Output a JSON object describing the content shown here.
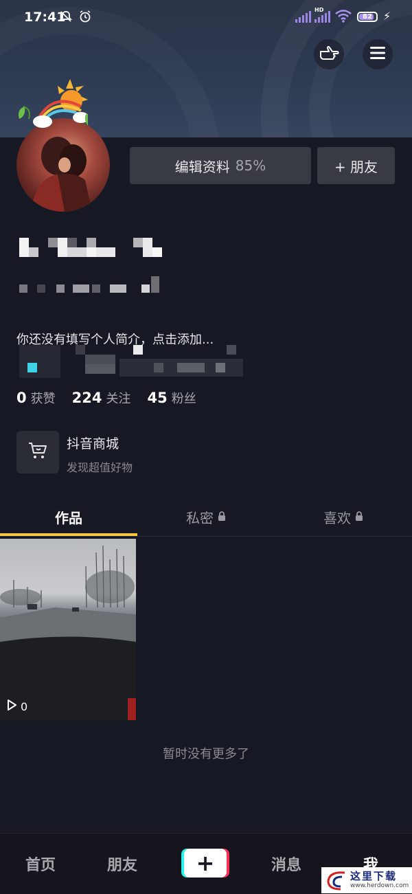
{
  "status_bar": {
    "time": "17:41",
    "battery": "82",
    "network": "HD"
  },
  "profile": {
    "edit_label": "编辑资料",
    "edit_percent": "85%",
    "add_friend_label": "+ 朋友",
    "bio": "你还没有填写个人简介，点击添加..."
  },
  "stats": [
    {
      "value": "0",
      "label": "获赞"
    },
    {
      "value": "224",
      "label": "关注"
    },
    {
      "value": "45",
      "label": "粉丝"
    }
  ],
  "shop": {
    "title": "抖音商城",
    "subtitle": "发现超值好物"
  },
  "tabs": [
    {
      "label": "作品",
      "locked": false
    },
    {
      "label": "私密",
      "locked": true
    },
    {
      "label": "喜欢",
      "locked": true
    }
  ],
  "video": {
    "play_count": "0"
  },
  "empty_text": "暂时没有更多了",
  "bottom_nav": [
    {
      "label": "首页"
    },
    {
      "label": "朋友"
    },
    {
      "label": "消息"
    },
    {
      "label": "我"
    }
  ],
  "watermark": {
    "text": "这里下载",
    "url": "www.herdown.com"
  },
  "colors": {
    "background": "#161823",
    "tab_indicator": "#f8c541",
    "accent_cyan": "#25f4ee",
    "accent_red": "#fe2c55"
  }
}
